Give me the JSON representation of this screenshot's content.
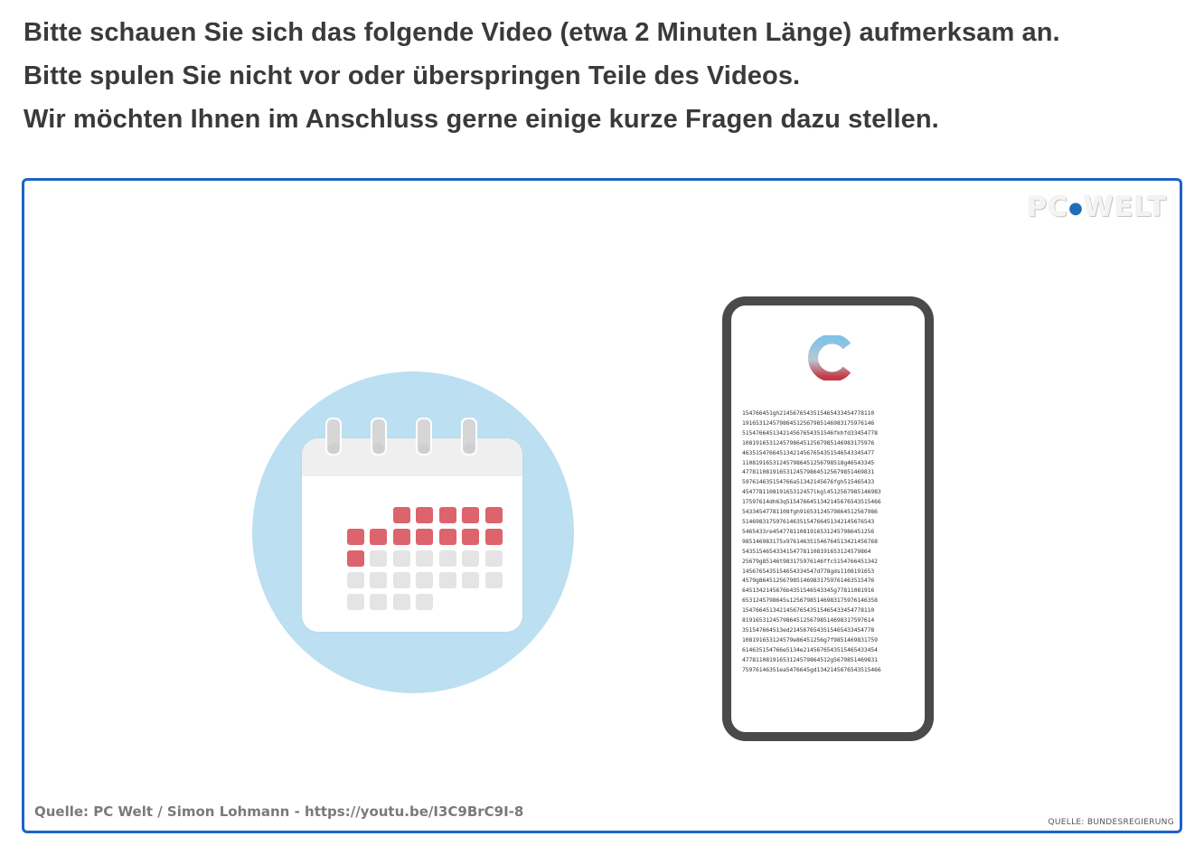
{
  "instructions": {
    "line1": "Bitte schauen Sie sich das folgende Video (etwa 2 Minuten Länge) aufmerksam an.",
    "line2": "Bitte spulen Sie nicht vor oder überspringen Teile des Videos.",
    "line3": "Wir möchten Ihnen im Anschluss gerne einige kurze Fragen dazu stellen."
  },
  "video": {
    "watermark_left": "PC",
    "watermark_right": "WELT",
    "source_left": "Quelle: PC Welt / Simon Lohmann  - https://youtu.be/I3C9BrC9I-8",
    "source_right": "QUELLE: BUNDESREGIERUNG",
    "calendar_icon": "calendar-icon",
    "app_icon": "corona-warn-app-icon",
    "colors": {
      "frame_border": "#1d63c7",
      "circle": "#bcdff1",
      "calendar_red": "#dd636c",
      "calendar_grey": "#e4e4e4",
      "phone_body": "#4a4a4a"
    },
    "phone_digits": [
      "154766451gh2145676543515465433454778110",
      "191653124579864512567985146983175976146",
      "515476645134214567654351546fkhfd33454778",
      "108191653124579864512567985146983175976",
      "463515476645134214567654351546543345477",
      "110819165312457986451256798518g46543345",
      "477811081916531245798645125679851469831",
      "597614635154766a51342145676fgh515465433",
      "454778110819165312457lkgl4512567985146983",
      "17597614dh63q5154766451342145676543515466",
      "54334547781108fgh91653124579864512567986",
      "514698317597614635154766451342145676543",
      "5465433re454778110819165312457986451256",
      "985146983175x976146351546764513421456768",
      "54351546543341547781108191653124579864",
      "25679g85146t983175976146ffc5154766451342",
      "1456765435154654334547d778gds1108191653",
      "4579g8645125679851469831759761463515476",
      "6451342145676b4351546543345g77811081916",
      "6531245798645s12567985146983175976146358",
      "154766451342145676543515465433454778110",
      "819165312457986451256798514698317597614",
      "351547664513ed2145676543515465433454778",
      "108191653124579e86451256g7f9851469831759",
      "614635154766e5134e2145676543515465433454",
      "47781108191653124579864512g5679851469831",
      "75976146351ea5476645gd1342145676543515466"
    ]
  }
}
